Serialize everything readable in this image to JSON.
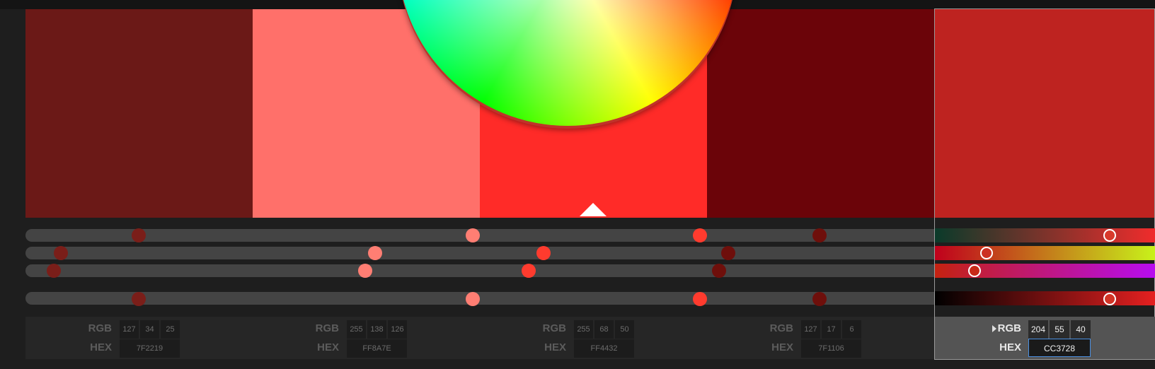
{
  "swatches": [
    {
      "color": "#6b1917",
      "rgb": [
        "127",
        "34",
        "25"
      ],
      "hex": "7F2219",
      "dot": "#7a1e19"
    },
    {
      "color": "#ff706a",
      "rgb": [
        "255",
        "138",
        "126"
      ],
      "hex": "FF8A7E",
      "dot": "#ff7e73"
    },
    {
      "color": "#ff2b28",
      "rgb": [
        "255",
        "68",
        "50"
      ],
      "hex": "FF4432",
      "dot": "#ff3b2e"
    },
    {
      "color": "#6b0409",
      "rgb": [
        "127",
        "17",
        "6"
      ],
      "hex": "7F1106",
      "dot": "#7a0f09"
    }
  ],
  "selected": {
    "color": "#be2320",
    "rgb": [
      "204",
      "55",
      "40"
    ],
    "hex": "CC3728",
    "gradients": [
      "#0a3a2a",
      "#c0001c",
      "#c42210",
      "#000000"
    ],
    "gradient_ends": [
      "#f02c2c",
      "#c8f21a",
      "#b80cf0",
      "#e52020"
    ]
  },
  "labels": {
    "rgb": "RGB",
    "hex": "HEX"
  }
}
